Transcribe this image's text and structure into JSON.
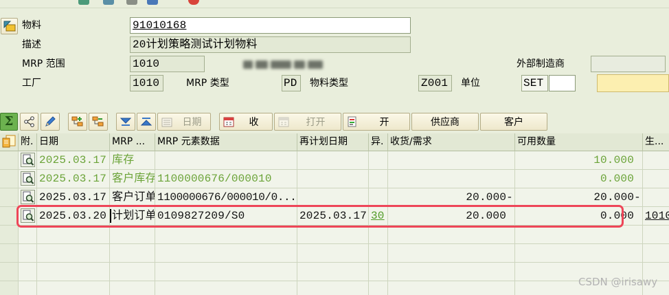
{
  "header": {
    "material_label": "物料",
    "material_value": "91010168",
    "description_label": "描述",
    "description_value": "20计划策略测试计划物料",
    "mrp_area_label": "MRP 范围",
    "mrp_area_value": "1010",
    "ext_mfr_label": "外部制造商",
    "ext_mfr_value": "",
    "plant_label": "工厂",
    "plant_value": "1010",
    "mrp_type_label": "MRP 类型",
    "mrp_type_value": "PD",
    "material_type_label": "物料类型",
    "material_type_value": "Z001",
    "unit_label": "单位",
    "unit_value": "SET"
  },
  "toolbar": {
    "date": "日期",
    "receipts": "收",
    "open_disabled": "打开",
    "open": "开",
    "vendor": "供应商",
    "customer": "客户"
  },
  "table": {
    "columns": {
      "attachment": "附.",
      "date": "日期",
      "mrp_element": "MRP ...",
      "element_data": "MRP 元素数据",
      "reschedule_date": "再计划日期",
      "exception": "异.",
      "receipt_requirement": "收货/需求",
      "available_qty": "可用数量",
      "production": "生..."
    },
    "rows": [
      {
        "date": "2025.03.17",
        "mrp_element": "库存",
        "element_data": "",
        "reschedule_date": "",
        "exception": "",
        "receipt_requirement": "",
        "available_qty": "10.000",
        "production": "",
        "text_color": "#6aa337"
      },
      {
        "date": "2025.03.17",
        "mrp_element": "客户库存",
        "element_data": "1100000676/000010",
        "reschedule_date": "",
        "exception": "",
        "receipt_requirement": "",
        "available_qty": "0.000",
        "production": "",
        "text_color": "#6aa337"
      },
      {
        "date": "2025.03.17",
        "mrp_element": "客户订单",
        "element_data": "1100000676/000010/0...",
        "reschedule_date": "",
        "exception": "",
        "receipt_requirement": "20.000-",
        "available_qty": "20.000-",
        "production": "",
        "text_color": "#111111"
      },
      {
        "date": "2025.03.20",
        "mrp_element": "计划订单",
        "element_data": "0109827209/S0",
        "reschedule_date": "2025.03.17",
        "exception": "30",
        "receipt_requirement": "20.000",
        "available_qty": "0.000",
        "production": "1010",
        "text_color": "#111111"
      }
    ]
  },
  "colors": {
    "background": "#e9eedc",
    "green_text": "#6aa337",
    "link_green": "#4f9a25",
    "annotation": "#ee4558",
    "disabled_text": "#9c9c88",
    "yellow_field": "#fcefb0"
  },
  "watermark": "CSDN @irisawy"
}
